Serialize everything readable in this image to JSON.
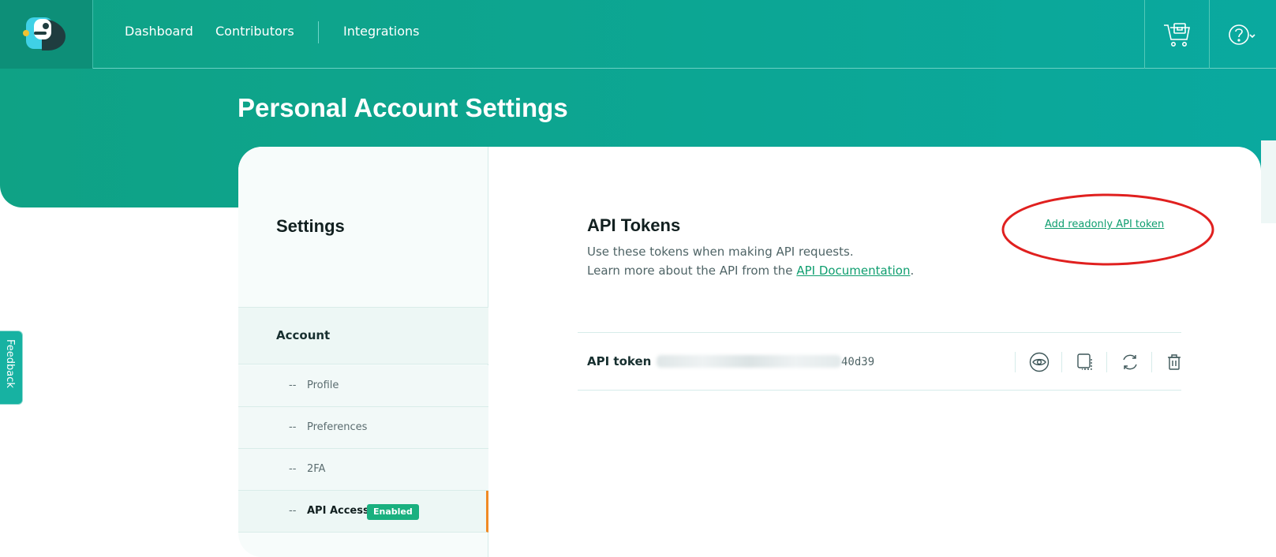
{
  "nav": {
    "links": [
      "Dashboard",
      "Contributors",
      "Integrations"
    ]
  },
  "hero": {
    "title": "Personal Account Settings"
  },
  "sidebar": {
    "heading": "Settings",
    "section": "Account",
    "dash": "--",
    "items": [
      {
        "label": "Profile"
      },
      {
        "label": "Preferences"
      },
      {
        "label": "2FA"
      },
      {
        "label": "API Access",
        "badge": "Enabled",
        "active": true
      }
    ]
  },
  "main": {
    "title": "API Tokens",
    "description_line1": "Use these tokens when making API requests.",
    "description_line2_prefix": "Learn more about the API from the",
    "doc_link": "API Documentation",
    "description_line2_suffix": ".",
    "add_token_link": "Add readonly API token",
    "token": {
      "label": "API token",
      "visible_suffix": "40d39"
    }
  },
  "feedback": {
    "label": "Feedback"
  },
  "icons": {
    "cart": "cart-icon",
    "help": "help-icon",
    "eye": "eye-icon",
    "copy": "copy-icon",
    "regenerate": "regenerate-icon",
    "delete": "trash-icon"
  },
  "colors": {
    "brand_teal": "#0fa285",
    "link_green": "#0f9e6f",
    "badge_green": "#19b07f",
    "active_accent": "#f08a24",
    "annotation_red": "#e0201f"
  }
}
